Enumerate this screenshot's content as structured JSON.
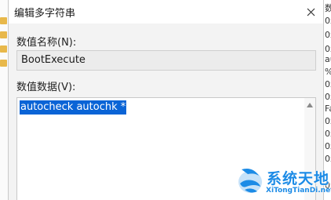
{
  "dialog": {
    "title": "编辑多字符串",
    "name_label": "数值名称(N):",
    "name_value": "BootExecute",
    "data_label": "数值数据(V):",
    "data_value": "autocheck autochk *"
  },
  "background": {
    "right_fragments": [
      "数",
      "0x",
      "0x",
      "0x",
      "au",
      "%",
      "0x",
      "0x",
      "Fa",
      "0x",
      "0x",
      "0x",
      "0x",
      "0x"
    ]
  },
  "watermark": {
    "text_cn": "系统天地",
    "text_en": "XiTongTianDi.net"
  },
  "colors": {
    "selection": "#0a64d6",
    "watermark": "#1c8be6"
  }
}
